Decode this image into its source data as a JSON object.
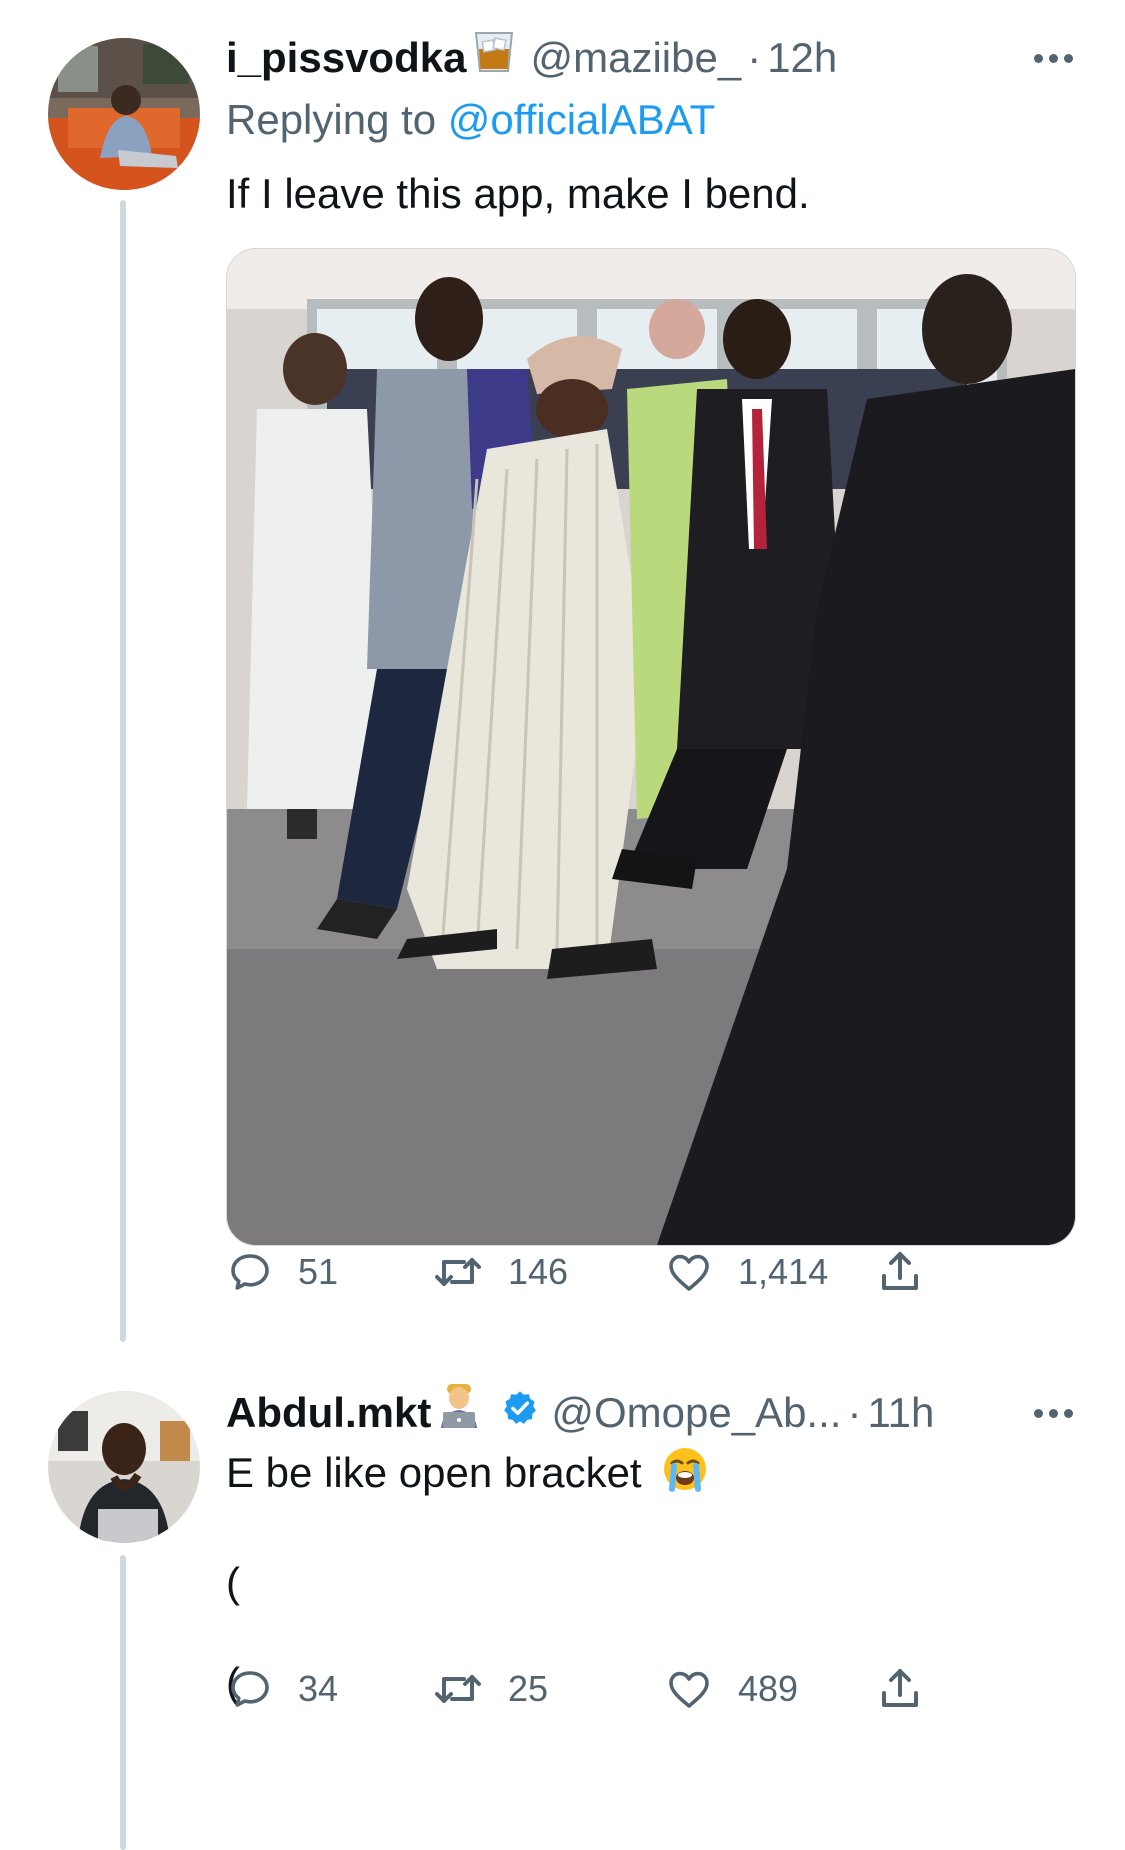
{
  "tweet1": {
    "display_name": "i_pissvodka",
    "name_emoji": "tumbler-glass-emoji",
    "handle": "@maziibe_",
    "dot": "·",
    "time": "12h",
    "replying_prefix": "Replying to",
    "replying_to": "@officialABAT",
    "text": "If I leave this app, make I bend.",
    "reply_count": "51",
    "retweet_count": "146",
    "like_count": "1,414"
  },
  "tweet2": {
    "display_name": "Abdul.mkt",
    "name_emoji": "technologist-emoji",
    "verified": "verified-badge",
    "handle": "@Omope_Ab...",
    "dot": "·",
    "time": "11h",
    "text_line1": "E be like open bracket",
    "text_emoji": "loudly-crying-face-emoji",
    "text_line2": "(",
    "text_line3": "(",
    "reply_count": "34",
    "retweet_count": "25",
    "like_count": "489"
  },
  "colors": {
    "text": "#0f1419",
    "secondary": "#536471",
    "accent": "#1d9bf0",
    "thread_line": "#cfd9de"
  }
}
